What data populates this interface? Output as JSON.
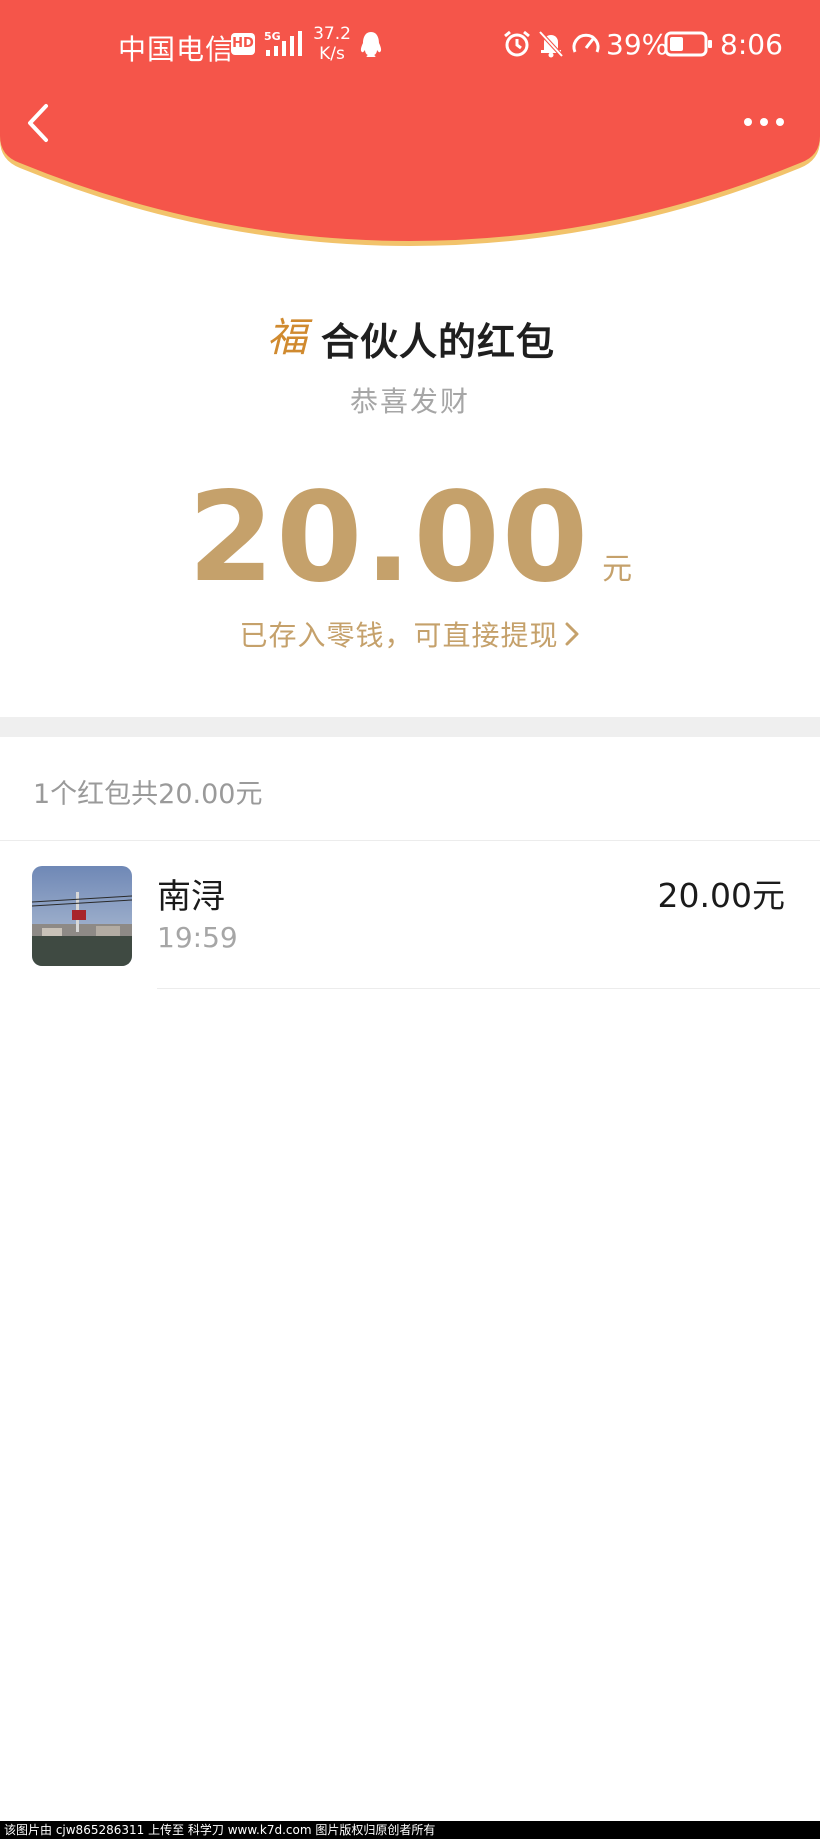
{
  "status_bar": {
    "carrier": "中国电信",
    "hd_badge": "HD",
    "network_type": "5G",
    "speed_value": "37.2",
    "speed_unit": "K/s",
    "battery_percent": "39%",
    "time": "8:06",
    "icons": [
      "signal-icon",
      "qq-icon",
      "alarm-icon",
      "mute-bell-icon",
      "speed-gauge-icon",
      "battery-icon"
    ]
  },
  "nav": {
    "back_icon": "chevron-left-icon",
    "more_icon": "more-dots-icon"
  },
  "packet": {
    "title": "合伙人的红包",
    "title_icon_glyph": "福",
    "blessing": "恭喜发财",
    "amount": "20.00",
    "unit": "元",
    "stored_link": "已存入零钱，可直接提现"
  },
  "summary": {
    "text": "1个红包共20.00元"
  },
  "receivers": [
    {
      "name": "南浔",
      "time": "19:59",
      "amount": "20.00元"
    }
  ],
  "watermark": "该图片由 cjw865286311 上传至 科学刀 www.k7d.com 图片版权归原创者所有",
  "colors": {
    "header_red": "#f5554a",
    "header_edge": "#f2c36b",
    "gold": "#c5a16b",
    "divider_gray": "#efefef"
  }
}
